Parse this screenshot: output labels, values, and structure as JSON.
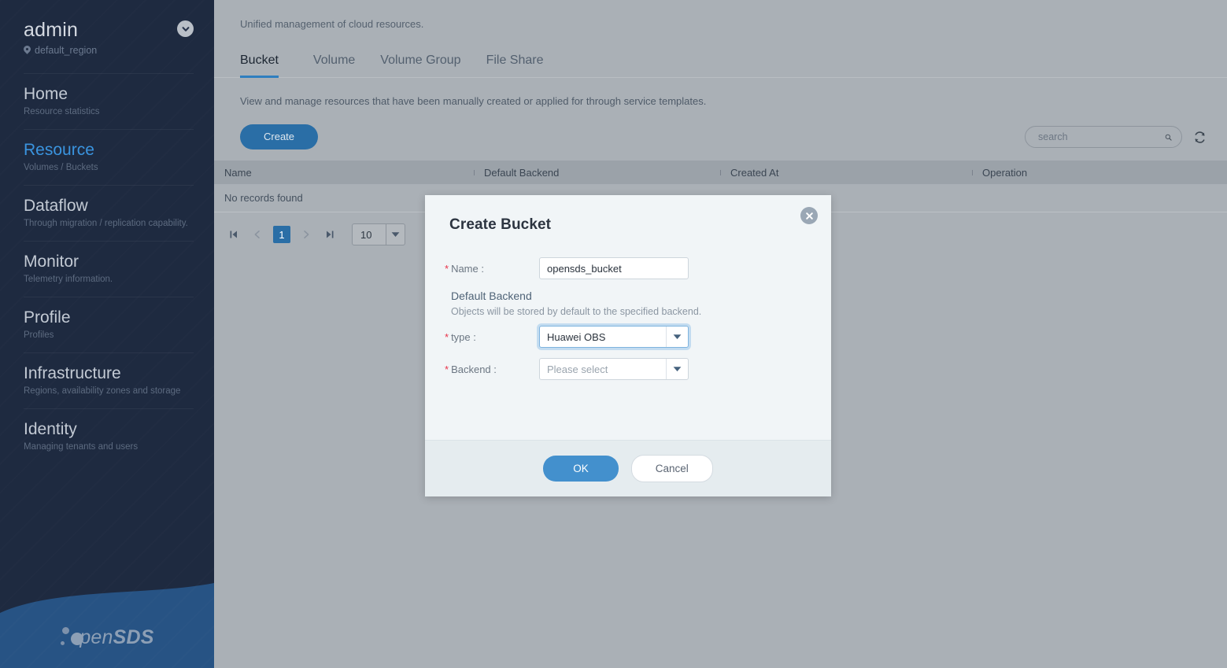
{
  "sidebar": {
    "user": {
      "name": "admin",
      "region": "default_region",
      "region_icon": "location-pin-icon",
      "caret_icon": "chevron-down-icon"
    },
    "items": [
      {
        "title": "Home",
        "subtitle": "Resource statistics",
        "active": false
      },
      {
        "title": "Resource",
        "subtitle": "Volumes / Buckets",
        "active": true
      },
      {
        "title": "Dataflow",
        "subtitle": "Through migration / replication capability.",
        "active": false
      },
      {
        "title": "Monitor",
        "subtitle": "Telemetry information.",
        "active": false
      },
      {
        "title": "Profile",
        "subtitle": "Profiles",
        "active": false
      },
      {
        "title": "Infrastructure",
        "subtitle": "Regions, availability zones and storage",
        "active": false
      },
      {
        "title": "Identity",
        "subtitle": "Managing tenants and users",
        "active": false
      }
    ],
    "logo": {
      "pen": "pen",
      "sds": "SDS",
      "alt": "opensds-logo"
    }
  },
  "main": {
    "subtitle": "Unified management of cloud resources.",
    "tabs": [
      {
        "label": "Bucket",
        "active": true
      },
      {
        "label": "Volume",
        "active": false
      },
      {
        "label": "Volume Group",
        "active": false
      },
      {
        "label": "File Share",
        "active": false
      }
    ],
    "description": "View and manage resources that have been manually created or applied for through service templates.",
    "toolbar": {
      "create_label": "Create",
      "search_placeholder": "search",
      "search_value": "",
      "search_icon": "search-icon",
      "refresh_icon": "refresh-icon"
    },
    "table": {
      "columns": [
        "Name",
        "Default Backend",
        "Created At",
        "Operation"
      ],
      "rows": [],
      "empty_text": "No records found"
    },
    "pagination": {
      "first_icon": "first-page-icon",
      "prev_icon": "prev-page-icon",
      "current_page": "1",
      "next_icon": "next-page-icon",
      "last_icon": "last-page-icon",
      "page_size": "10",
      "page_size_caret": "caret-down-icon"
    }
  },
  "modal": {
    "title": "Create Bucket",
    "close_icon": "close-icon",
    "fields": {
      "name_label": "Name :",
      "name_value": "opensds_bucket",
      "section_title": "Default Backend",
      "section_hint": "Objects will be stored by default to the specified backend.",
      "type_label": "type :",
      "type_value": "Huawei OBS",
      "backend_label": "Backend :",
      "backend_placeholder": "Please select",
      "required_mark": "*",
      "caret_icon": "caret-down-icon"
    },
    "ok_label": "OK",
    "cancel_label": "Cancel"
  },
  "colors": {
    "sidebar_bg": "#1e2a40",
    "sidebar_wave": "#275384",
    "accent_blue": "#2a6ea6",
    "active_nav": "#3a94df",
    "main_bg": "#aab0b6",
    "modal_bg": "#f1f5f7",
    "required_red": "#e8334a",
    "ok_button": "#4390cd"
  }
}
